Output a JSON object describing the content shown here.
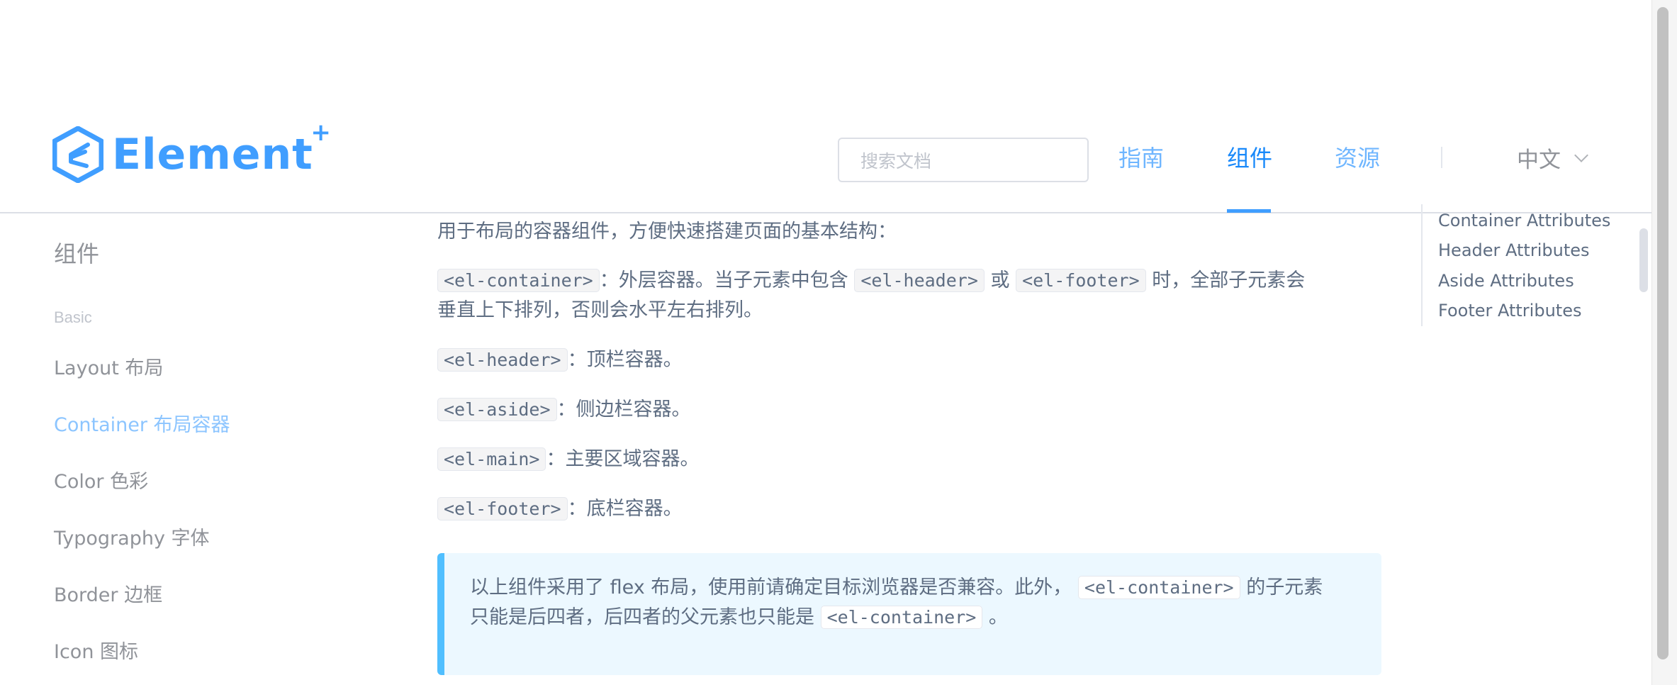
{
  "header": {
    "logo_text": "Element",
    "logo_plus": "+",
    "search_placeholder": "搜索文档",
    "nav": [
      {
        "label": "指南",
        "active": false
      },
      {
        "label": "组件",
        "active": true
      },
      {
        "label": "资源",
        "active": false
      }
    ],
    "language": "中文"
  },
  "sidebar": {
    "title": "组件",
    "group": "Basic",
    "items": [
      {
        "label": "Layout 布局",
        "active": false
      },
      {
        "label": "Container 布局容器",
        "active": true
      },
      {
        "label": "Color 色彩",
        "active": false
      },
      {
        "label": "Typography 字体",
        "active": false
      },
      {
        "label": "Border 边框",
        "active": false
      },
      {
        "label": "Icon 图标",
        "active": false
      }
    ]
  },
  "content": {
    "intro": "用于布局的容器组件，方便快速搭建页面的基本结构：",
    "container_desc": {
      "code1": "<el-container>",
      "text1": "：外层容器。当子元素中包含",
      "code2": "<el-header>",
      "text2": "或",
      "code3": "<el-footer>",
      "text3": "时，全部子元素会",
      "text4": "垂直上下排列，否则会水平左右排列。"
    },
    "header_desc": {
      "code": "<el-header>",
      "text": "：顶栏容器。"
    },
    "aside_desc": {
      "code": "<el-aside>",
      "text": "：侧边栏容器。"
    },
    "main_desc": {
      "code": "<el-main>",
      "text": "：主要区域容器。"
    },
    "footer_desc": {
      "code": "<el-footer>",
      "text": "：底栏容器。"
    },
    "tip": {
      "text1": "以上组件采用了 flex 布局，使用前请确定目标浏览器是否兼容。此外，",
      "code1": "<el-container>",
      "text2": "的子元素",
      "text3": "只能是后四者，后四者的父元素也只能是",
      "code2": "<el-container>",
      "text4": "。"
    }
  },
  "toc": {
    "items": [
      "Container Attributes",
      "Header Attributes",
      "Aside Attributes",
      "Footer Attributes"
    ]
  },
  "colors": {
    "primary": "#409eff",
    "sidebar_active": "#8cc5ff",
    "tip_background": "#ecf8ff",
    "tip_border": "#50bfff"
  }
}
